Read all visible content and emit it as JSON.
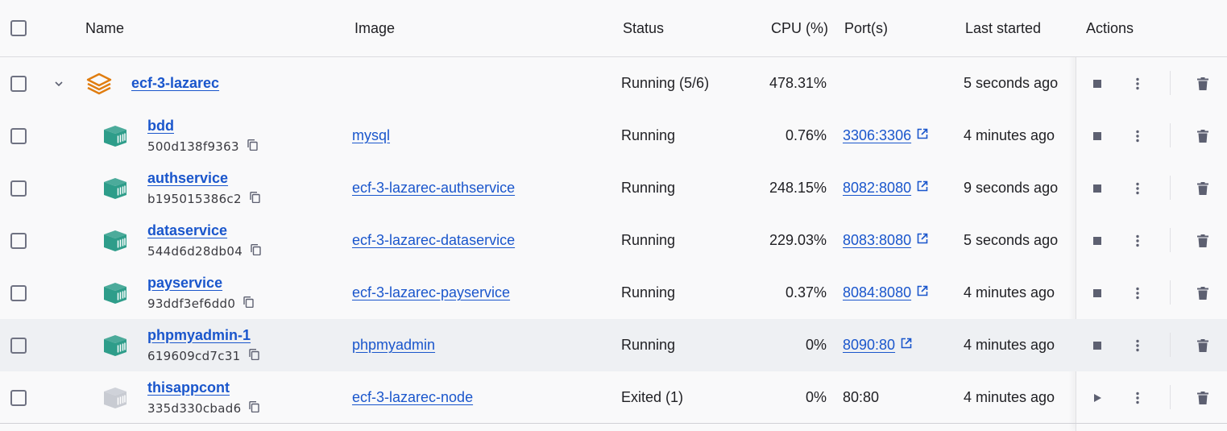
{
  "header": {
    "name": "Name",
    "image": "Image",
    "status": "Status",
    "cpu": "CPU (%)",
    "ports": "Port(s)",
    "last_started": "Last started",
    "actions": "Actions"
  },
  "group": {
    "name": "ecf-3-lazarec",
    "status": "Running (5/6)",
    "cpu": "478.31%",
    "last_started": "5 seconds ago",
    "icon": "stack-icon",
    "color": "#e07d10"
  },
  "containers": [
    {
      "name": "bdd",
      "id": "500d138f9363",
      "image": "mysql",
      "status": "Running",
      "cpu": "0.76%",
      "port": "3306:3306",
      "port_link": true,
      "last_started": "4 minutes ago",
      "running": true
    },
    {
      "name": "authservice",
      "id": "b195015386c2",
      "image": "ecf-3-lazarec-authservice",
      "status": "Running",
      "cpu": "248.15%",
      "port": "8082:8080",
      "port_link": true,
      "last_started": "9 seconds ago",
      "running": true
    },
    {
      "name": "dataservice",
      "id": "544d6d28db04",
      "image": "ecf-3-lazarec-dataservice",
      "status": "Running",
      "cpu": "229.03%",
      "port": "8083:8080",
      "port_link": true,
      "last_started": "5 seconds ago",
      "running": true
    },
    {
      "name": "payservice",
      "id": "93ddf3ef6dd0",
      "image": "ecf-3-lazarec-payservice",
      "status": "Running",
      "cpu": "0.37%",
      "port": "8084:8080",
      "port_link": true,
      "last_started": "4 minutes ago",
      "running": true
    },
    {
      "name": "phpmyadmin-1",
      "id": "619609cd7c31",
      "image": "phpmyadmin",
      "status": "Running",
      "cpu": "0%",
      "port": "8090:80",
      "port_link": true,
      "last_started": "4 minutes ago",
      "running": true
    },
    {
      "name": "thisappcont",
      "id": "335d330cbad6",
      "image": "ecf-3-lazarec-node",
      "status": "Exited (1)",
      "cpu": "0%",
      "port": "80:80",
      "port_link": false,
      "last_started": "4 minutes ago",
      "running": false
    }
  ],
  "colors": {
    "link": "#1a56cc",
    "running_icon": "#2e9d8a",
    "stopped_icon": "#c8cbd2",
    "action_icon": "#5d6071",
    "group_icon": "#e07d10"
  },
  "icons": {
    "container": "container-icon",
    "copy": "copy-icon",
    "external": "external-link-icon",
    "stop": "stop-icon",
    "start": "play-icon",
    "more": "more-vertical-icon",
    "delete": "trash-icon",
    "expand": "chevron-down-icon"
  }
}
